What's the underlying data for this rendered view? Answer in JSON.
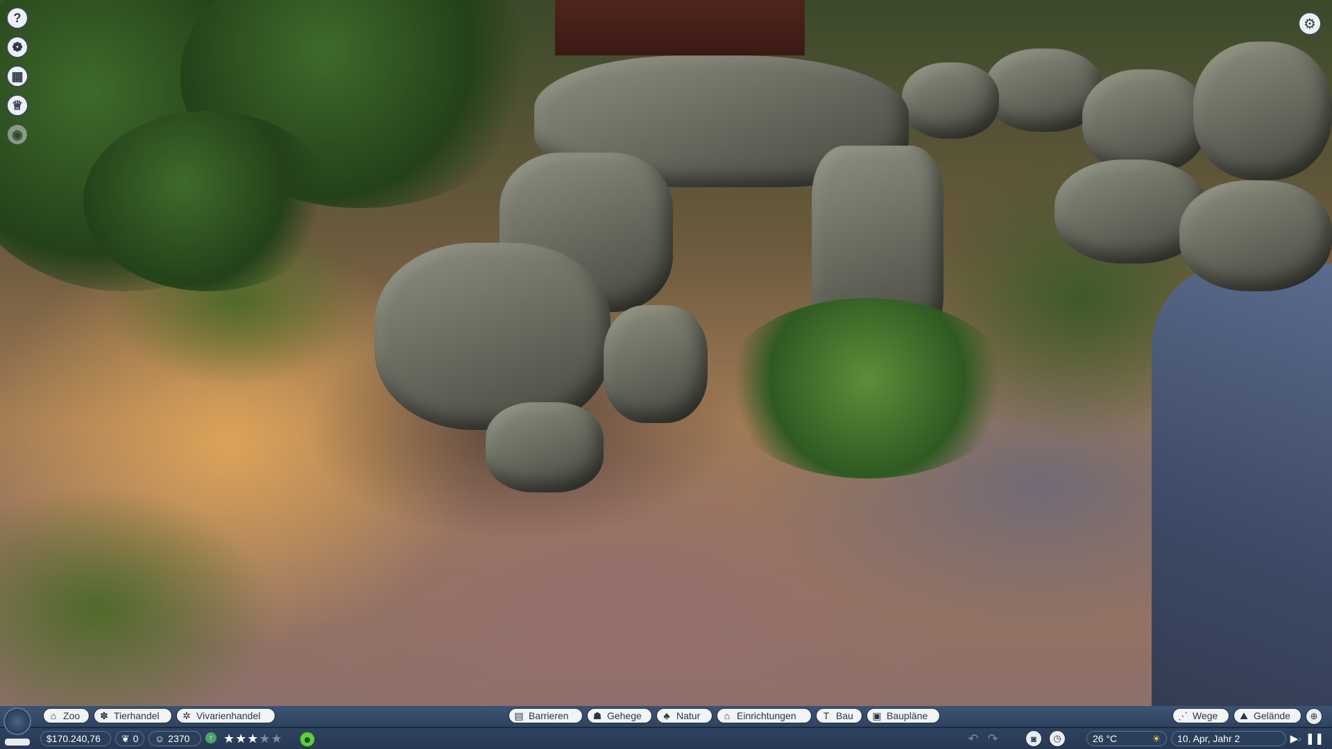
{
  "side_toolbar": [
    {
      "icon": "help-icon",
      "glyph": "?"
    },
    {
      "icon": "animal-head-icon",
      "glyph": "❁"
    },
    {
      "icon": "calendar-icon",
      "glyph": "▦"
    },
    {
      "icon": "trophy-icon",
      "glyph": "♕"
    },
    {
      "icon": "eye-icon",
      "glyph": "◉"
    }
  ],
  "settings_icon": {
    "icon": "gear-icon",
    "glyph": "⚙"
  },
  "hud": {
    "left_tabs": [
      {
        "label": "Zoo",
        "icon": "zoo-sign-icon",
        "glyph": "⌂"
      },
      {
        "label": "Tierhandel",
        "icon": "paw-icon",
        "glyph": "✽"
      },
      {
        "label": "Vivarienhandel",
        "icon": "bug-icon",
        "glyph": "✲"
      }
    ],
    "center_tabs": [
      {
        "label": "Barrieren",
        "icon": "barrier-icon",
        "glyph": "▤"
      },
      {
        "label": "Gehege",
        "icon": "habitat-icon",
        "glyph": "☗"
      },
      {
        "label": "Natur",
        "icon": "tree-icon",
        "glyph": "♣"
      },
      {
        "label": "Einrichtungen",
        "icon": "building-icon",
        "glyph": "⌂"
      },
      {
        "label": "Bau",
        "icon": "construction-icon",
        "glyph": "T"
      },
      {
        "label": "Baupläne",
        "icon": "blueprint-icon",
        "glyph": "▣"
      }
    ],
    "right_tabs": [
      {
        "label": "Wege",
        "icon": "path-icon",
        "glyph": "⋰"
      },
      {
        "label": "Gelände",
        "icon": "terrain-icon",
        "glyph": "⛰"
      }
    ],
    "money": "$170.240,76",
    "conservation": "0",
    "guests": "2370",
    "rating_stars": 2.5,
    "temperature": "26 °C",
    "date": "10. Apr, Jahr 2",
    "colors": {
      "hud_bg": "#2e4360",
      "pill_bg": "#f1f3f5",
      "happy": "#5fcf3f"
    }
  }
}
